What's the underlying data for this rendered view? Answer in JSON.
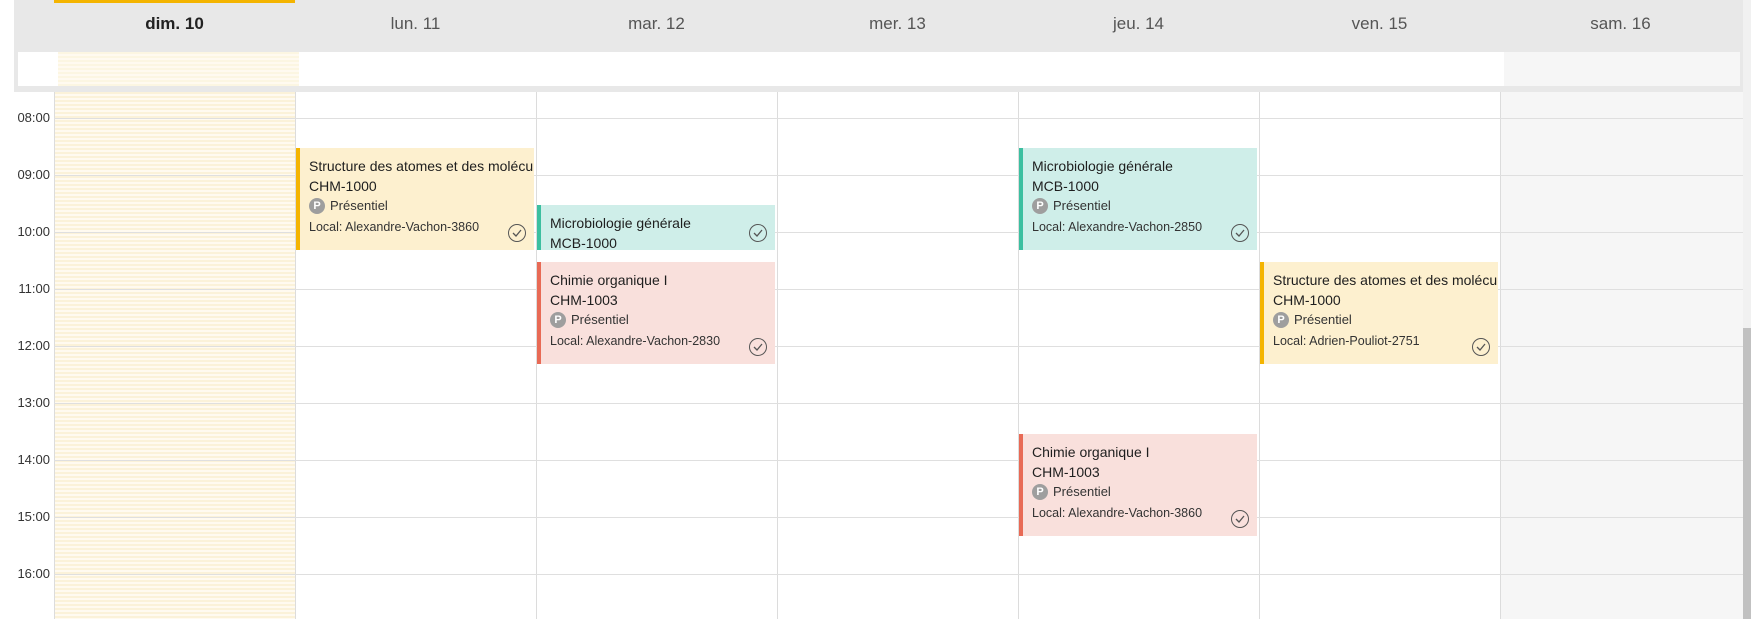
{
  "days": [
    {
      "label": "dim. 10",
      "active": true
    },
    {
      "label": "lun. 11",
      "active": false
    },
    {
      "label": "mar. 12",
      "active": false
    },
    {
      "label": "mer. 13",
      "active": false
    },
    {
      "label": "jeu. 14",
      "active": false
    },
    {
      "label": "ven. 15",
      "active": false
    },
    {
      "label": "sam. 16",
      "active": false
    }
  ],
  "times": [
    "08:00",
    "09:00",
    "10:00",
    "11:00",
    "12:00",
    "13:00",
    "14:00",
    "15:00",
    "16:00"
  ],
  "events": [
    {
      "day": 1,
      "title": "Structure des atomes et des molécu",
      "code": "CHM-1000",
      "mode": "Présentiel",
      "mode_badge": "P",
      "local": "Local: Alexandre-Vachon-3860",
      "color": "yellow"
    },
    {
      "day": 2,
      "title": "Microbiologie générale",
      "code": "MCB-1000",
      "color": "teal"
    },
    {
      "day": 2,
      "title": "Chimie organique I",
      "code": "CHM-1003",
      "mode": "Présentiel",
      "mode_badge": "P",
      "local": "Local: Alexandre-Vachon-2830",
      "color": "red"
    },
    {
      "day": 4,
      "title": "Microbiologie générale",
      "code": "MCB-1000",
      "mode": "Présentiel",
      "mode_badge": "P",
      "local": "Local: Alexandre-Vachon-2850",
      "color": "teal"
    },
    {
      "day": 4,
      "title": "Chimie organique I",
      "code": "CHM-1003",
      "mode": "Présentiel",
      "mode_badge": "P",
      "local": "Local: Alexandre-Vachon-3860",
      "color": "red"
    },
    {
      "day": 5,
      "title": "Structure des atomes et des molécu",
      "code": "CHM-1000",
      "mode": "Présentiel",
      "mode_badge": "P",
      "local": "Local: Adrien-Pouliot-2751",
      "color": "yellow"
    }
  ],
  "colors": {
    "accent": "#f4b400",
    "teal": "#3cbfa0",
    "red": "#e86a55"
  }
}
